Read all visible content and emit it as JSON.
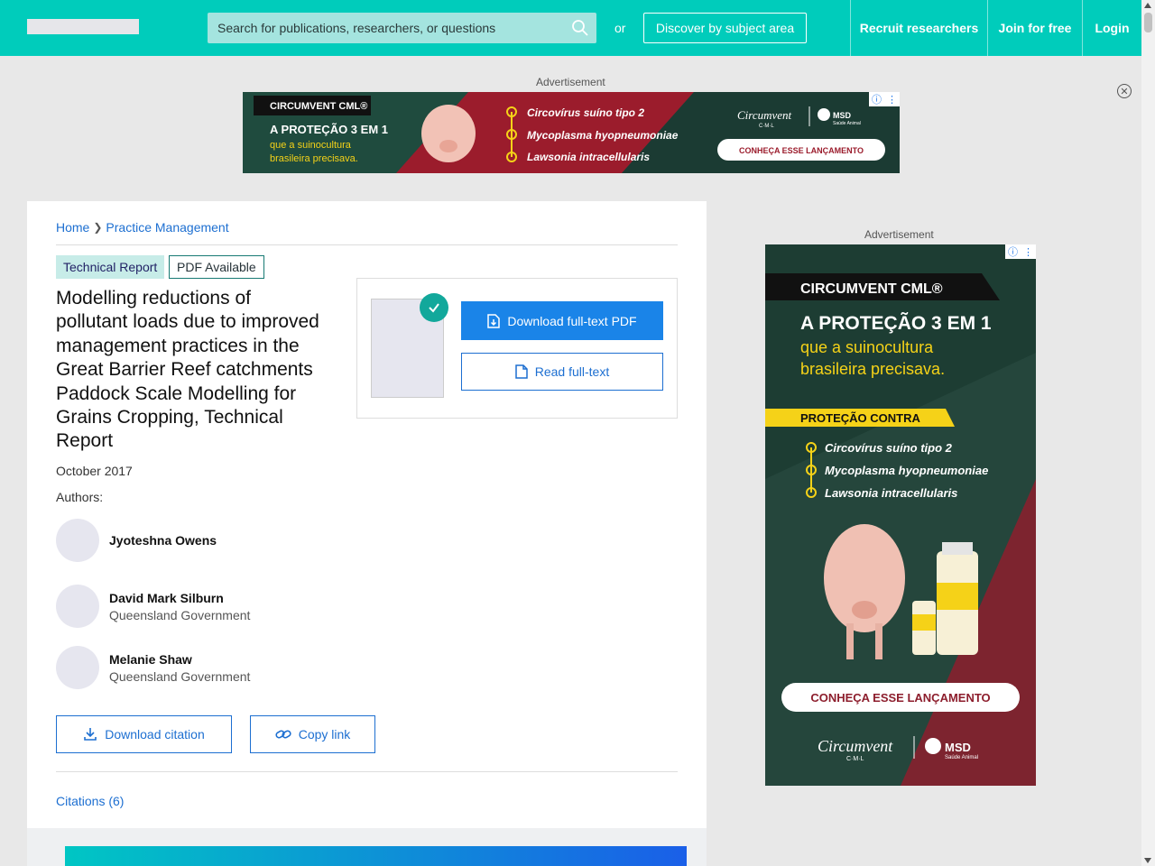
{
  "header": {
    "search_placeholder": "Search for publications, researchers, or questions",
    "or_text": "or",
    "discover_label": "Discover by subject area",
    "recruit_label": "Recruit researchers",
    "join_label": "Join for free",
    "login_label": "Login"
  },
  "ads": {
    "label": "Advertisement",
    "top": {
      "brand": "CIRCUMVENT CML®",
      "headline": "A PROTEÇÃO 3 EM 1",
      "subline1": "que a suinocultura",
      "subline2": "brasileira precisava.",
      "items": [
        "Circovírus suíno tipo 2",
        "Mycoplasma hyopneumoniae",
        "Lawsonia intracellularis"
      ],
      "product": "Circumvent",
      "product_sub": "C·M·L",
      "maker": "MSD",
      "maker_sub": "Saúde Animal",
      "cta": "CONHEÇA ESSE LANÇAMENTO"
    },
    "side": {
      "brand": "CIRCUMVENT CML®",
      "headline": "A PROTEÇÃO 3 EM 1",
      "subline1": "que a suinocultura",
      "subline2": "brasileira precisava.",
      "protection": "PROTEÇÃO CONTRA",
      "items": [
        "Circovírus suíno tipo 2",
        "Mycoplasma hyopneumoniae",
        "Lawsonia intracellularis"
      ],
      "cta": "CONHEÇA ESSE LANÇAMENTO",
      "product": "Circumvent",
      "product_sub": "C·M·L",
      "maker": "MSD",
      "maker_sub": "Saúde Animal"
    }
  },
  "breadcrumb": {
    "home": "Home",
    "section": "Practice Management"
  },
  "tags": {
    "type": "Technical Report",
    "pdf": "PDF Available"
  },
  "publication": {
    "title": "Modelling reductions of pollutant loads due to improved management practices in the Great Barrier Reef catchments Paddock Scale Modelling for Grains Cropping, Technical Report",
    "date": "October 2017",
    "authors_label": "Authors:",
    "authors": [
      {
        "name": "Jyoteshna Owens",
        "affiliation": ""
      },
      {
        "name": "David Mark Silburn",
        "affiliation": "Queensland Government"
      },
      {
        "name": "Melanie Shaw",
        "affiliation": "Queensland Government"
      }
    ]
  },
  "actions": {
    "download_pdf": "Download full-text PDF",
    "read_fulltext": "Read full-text",
    "download_citation": "Download citation",
    "copy_link": "Copy link",
    "citations": "Citations (6)"
  },
  "colors": {
    "header": "#00ccbb",
    "primary": "#1a84e8",
    "link": "#1d6fd1",
    "check": "#12a89b"
  }
}
